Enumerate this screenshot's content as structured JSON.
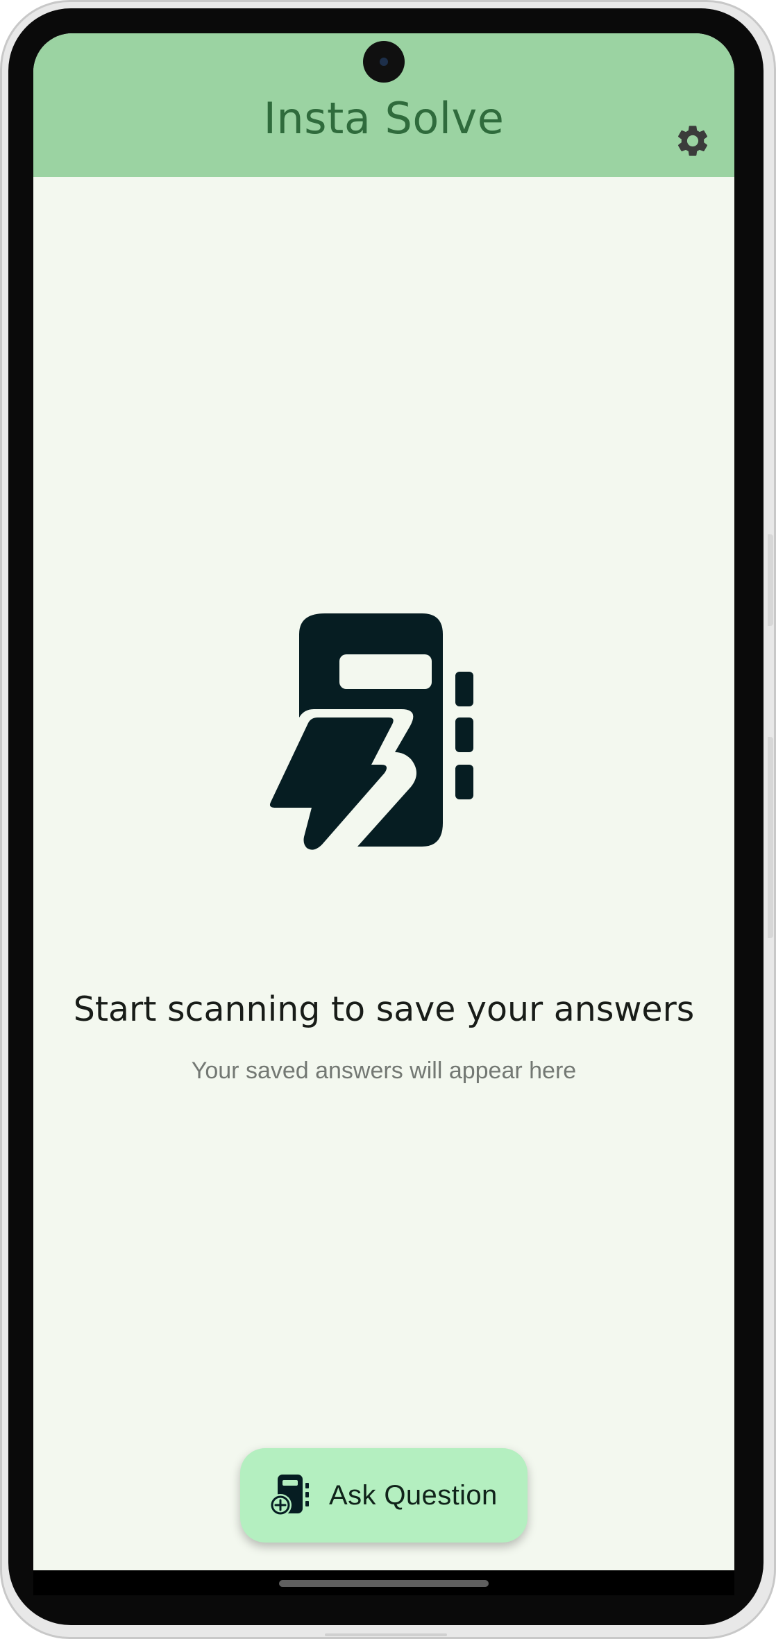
{
  "app_bar": {
    "title": "Insta Solve",
    "settings_icon": "gear-icon",
    "background": "#9bd3a2",
    "title_color": "#2f6b3c"
  },
  "empty_state": {
    "icon": "notebook-lightning-icon",
    "headline": "Start scanning to save your answers",
    "subtitle": "Your saved answers will appear here"
  },
  "fab": {
    "label": "Ask Question",
    "icon": "add-notebook-icon",
    "background": "#b4efc0"
  },
  "colors": {
    "screen_background": "#f3f8ef",
    "icon_dark": "#061d22"
  }
}
